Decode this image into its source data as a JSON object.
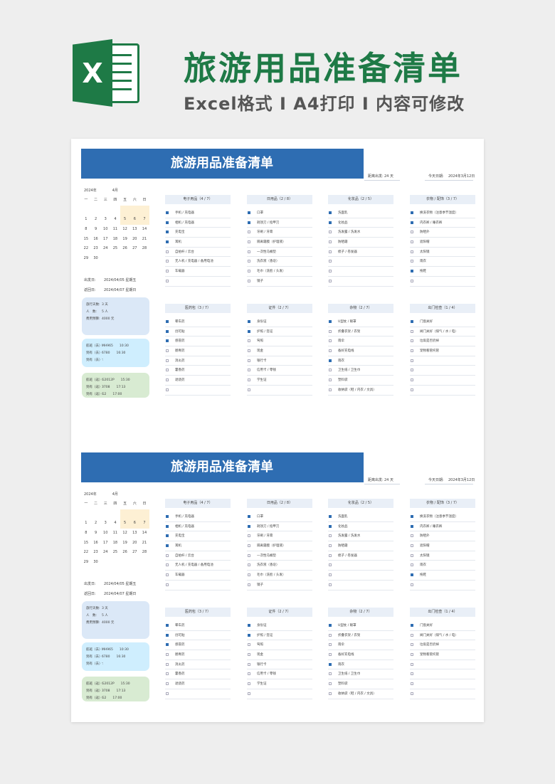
{
  "banner": {
    "logo_letter": "X",
    "title": "旅游用品准备清单",
    "subtitle": "Excel格式 I A4打印 I 内容可修改"
  },
  "colors": {
    "brand_green": "#1e7a46",
    "header_blue": "#2e6db2",
    "check_blue": "#2e6db2"
  },
  "icons": {
    "logo": "excel-logo-icon",
    "checkbox": "checkbox-icon"
  },
  "sheet": {
    "title": "旅游用品准备清单",
    "distance_label": "距离出发:",
    "distance_value": "24 天",
    "today_label": "今天日期:",
    "today_value": "2024年3月12日",
    "year": "2024年",
    "month": "4月",
    "weekdays": [
      "一",
      "二",
      "三",
      "四",
      "五",
      "六",
      "日"
    ],
    "calendar": [
      {
        "d": "",
        "hl": false
      },
      {
        "d": "",
        "hl": false
      },
      {
        "d": "",
        "hl": false
      },
      {
        "d": "",
        "hl": false
      },
      {
        "d": "",
        "hl": true
      },
      {
        "d": "",
        "hl": true
      },
      {
        "d": "",
        "hl": true
      },
      {
        "d": "1",
        "hl": false
      },
      {
        "d": "2",
        "hl": false
      },
      {
        "d": "3",
        "hl": false
      },
      {
        "d": "4",
        "hl": false
      },
      {
        "d": "5",
        "hl": true
      },
      {
        "d": "6",
        "hl": true
      },
      {
        "d": "7",
        "hl": true
      },
      {
        "d": "8",
        "hl": false
      },
      {
        "d": "9",
        "hl": false
      },
      {
        "d": "10",
        "hl": false
      },
      {
        "d": "11",
        "hl": false
      },
      {
        "d": "12",
        "hl": false
      },
      {
        "d": "13",
        "hl": false
      },
      {
        "d": "14",
        "hl": false
      },
      {
        "d": "15",
        "hl": false
      },
      {
        "d": "16",
        "hl": false
      },
      {
        "d": "17",
        "hl": false
      },
      {
        "d": "18",
        "hl": false
      },
      {
        "d": "19",
        "hl": false
      },
      {
        "d": "20",
        "hl": false
      },
      {
        "d": "21",
        "hl": false
      },
      {
        "d": "22",
        "hl": false
      },
      {
        "d": "23",
        "hl": false
      },
      {
        "d": "24",
        "hl": false
      },
      {
        "d": "25",
        "hl": false
      },
      {
        "d": "26",
        "hl": false
      },
      {
        "d": "27",
        "hl": false
      },
      {
        "d": "28",
        "hl": false
      },
      {
        "d": "29",
        "hl": false
      },
      {
        "d": "30",
        "hl": false
      }
    ],
    "depart_label": "出发日:",
    "depart_value": "2024/04/05 星期五",
    "return_label": "返回日:",
    "return_value": "2024/04/07 星期日",
    "trip_info": [
      {
        "k": "旅行天数:",
        "v": "3 天"
      },
      {
        "k": "人　数:",
        "v": "5 人"
      },
      {
        "k": "费用预算:",
        "v": "4000 元"
      }
    ],
    "train_info": [
      {
        "k": "航班（去）:",
        "v": "MH965　　10:30"
      },
      {
        "k": "到有（去）:",
        "v": "6780　　16:30"
      },
      {
        "k": "到有（去）:",
        "v": "-"
      }
    ],
    "return_info": [
      {
        "k": "航班（返）:",
        "v": "G2012P　　15:30"
      },
      {
        "k": "到有（返）:",
        "v": "3708　　17:13"
      },
      {
        "k": "到有（返）:",
        "v": "G2　　17:00"
      }
    ],
    "categories": [
      {
        "title": "电子用品（4 / 7）",
        "items": [
          {
            "label": "手机 / 充电器",
            "checked": true
          },
          {
            "label": "相机 / 充电器",
            "checked": true
          },
          {
            "label": "充电宝",
            "checked": true
          },
          {
            "label": "耳机",
            "checked": true
          },
          {
            "label": "自拍杆 / 云台",
            "checked": false
          },
          {
            "label": "无人机 / 充电器 / 备用电池",
            "checked": false
          },
          {
            "label": "车载器",
            "checked": false
          },
          {
            "label": "",
            "checked": false
          }
        ]
      },
      {
        "title": "日用品（2 / 8）",
        "items": [
          {
            "label": "口罩",
            "checked": true
          },
          {
            "label": "剃须刀 / 指甲刀",
            "checked": true
          },
          {
            "label": "牙刷 / 牙膏",
            "checked": false
          },
          {
            "label": "隔离霜膜（护理液）",
            "checked": false
          },
          {
            "label": "一次性马桶垫",
            "checked": false
          },
          {
            "label": "洗衣液（香皂）",
            "checked": false
          },
          {
            "label": "毛巾（洗脸 / 头发）",
            "checked": false
          },
          {
            "label": "镜子",
            "checked": false
          }
        ]
      },
      {
        "title": "化妆品（2 / 5）",
        "items": [
          {
            "label": "洗面乳",
            "checked": true
          },
          {
            "label": "化妆品",
            "checked": true
          },
          {
            "label": "洗发露 / 洗发水",
            "checked": false
          },
          {
            "label": "防晒霜",
            "checked": false
          },
          {
            "label": "梳子 / 卷发器",
            "checked": false
          },
          {
            "label": "",
            "checked": false
          },
          {
            "label": "",
            "checked": false
          },
          {
            "label": "",
            "checked": false
          }
        ]
      },
      {
        "title": "衣物 / 配饰（3 / 7）",
        "items": [
          {
            "label": "换洗衣物（注意季节温度）",
            "checked": true
          },
          {
            "label": "内衣裤 / 睡衣裤",
            "checked": true
          },
          {
            "label": "防晒外",
            "checked": false
          },
          {
            "label": "遮阳帽",
            "checked": false
          },
          {
            "label": "太阳镜",
            "checked": false
          },
          {
            "label": "雨衣",
            "checked": false
          },
          {
            "label": "拖鞋",
            "checked": true
          },
          {
            "label": "",
            "checked": false
          }
        ]
      },
      {
        "title": "医药包（3 / 7）",
        "items": [
          {
            "label": "晕车药",
            "checked": true
          },
          {
            "label": "创可贴",
            "checked": true
          },
          {
            "label": "感冒药",
            "checked": true
          },
          {
            "label": "肠胃药",
            "checked": false
          },
          {
            "label": "消炎药",
            "checked": false
          },
          {
            "label": "藿香药",
            "checked": false
          },
          {
            "label": "退烧药",
            "checked": false
          },
          {
            "label": "",
            "checked": false
          }
        ]
      },
      {
        "title": "证件（2 / 7）",
        "items": [
          {
            "label": "身份证",
            "checked": true
          },
          {
            "label": "护照 / 签证",
            "checked": true
          },
          {
            "label": "驾照",
            "checked": false
          },
          {
            "label": "现金",
            "checked": false
          },
          {
            "label": "银行卡",
            "checked": false
          },
          {
            "label": "信用卡 / 零钱",
            "checked": false
          },
          {
            "label": "学生证",
            "checked": false
          },
          {
            "label": "",
            "checked": false
          }
        ]
      },
      {
        "title": "杂物（2 / 7）",
        "items": [
          {
            "label": "U型枕 / 眼罩",
            "checked": true
          },
          {
            "label": "折叠衣架 / 衣架",
            "checked": false
          },
          {
            "label": "雨伞",
            "checked": false
          },
          {
            "label": "备好充电线",
            "checked": false
          },
          {
            "label": "雨衣",
            "checked": true
          },
          {
            "label": "卫生纸 / 卫生巾",
            "checked": false
          },
          {
            "label": "塑料袋",
            "checked": false
          },
          {
            "label": "收纳袋（鞋 / 内衣 / 文具）",
            "checked": false
          }
        ]
      },
      {
        "title": "出门检查（1 / 4）",
        "items": [
          {
            "label": "门窗关好",
            "checked": true
          },
          {
            "label": "阀门关好（煤气 / 水 / 电）",
            "checked": false
          },
          {
            "label": "垃圾是否扔掉",
            "checked": false
          },
          {
            "label": "宠物看管托管",
            "checked": false
          },
          {
            "label": "",
            "checked": false
          },
          {
            "label": "",
            "checked": false
          },
          {
            "label": "",
            "checked": false
          },
          {
            "label": "",
            "checked": false
          }
        ]
      }
    ]
  }
}
